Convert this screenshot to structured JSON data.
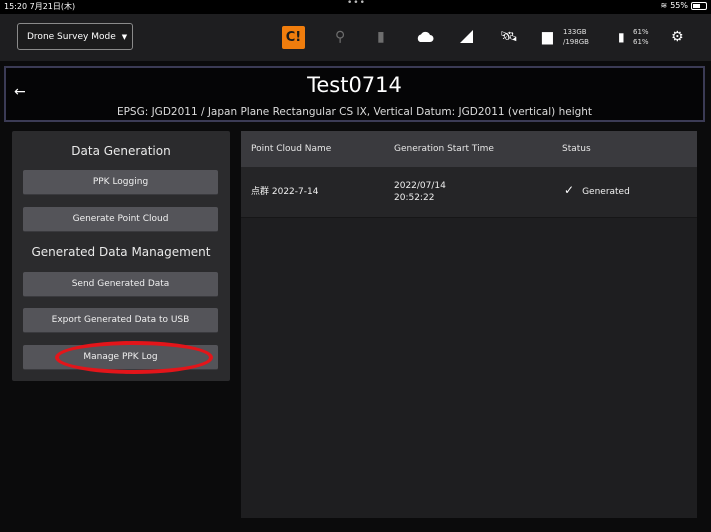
{
  "status_bar": {
    "time": "15:20",
    "date": "7月21日(木)",
    "dots": "•••",
    "battery": "55%"
  },
  "toolbar": {
    "mode": "Drone Survey Mode",
    "storage_used": "133GB",
    "storage_total": "/198GB",
    "battery_top": "61%",
    "battery_bottom": "61%"
  },
  "header": {
    "title": "Test0714",
    "subtitle": "EPSG: JGD2011 / Japan Plane Rectangular CS IX, Vertical Datum: JGD2011 (vertical) height"
  },
  "left_panel": {
    "data_generation_title": "Data Generation",
    "ppk_logging": "PPK Logging",
    "generate_point_cloud": "Generate Point Cloud",
    "management_title": "Generated Data Management",
    "send_generated_data": "Send Generated Data",
    "export_usb": "Export Generated Data to USB",
    "manage_ppk_log": "Manage PPK Log"
  },
  "table": {
    "headers": [
      "Point Cloud Name",
      "Generation Start Time",
      "Status"
    ],
    "rows": [
      {
        "name": "点群 2022-7-14",
        "date": "2022/07/14",
        "time": "20:52:22",
        "status": "Generated"
      }
    ]
  },
  "colors": {
    "warning": "#f07d0d",
    "annotation": "#e3151a",
    "header_border": "#3b3b55"
  }
}
